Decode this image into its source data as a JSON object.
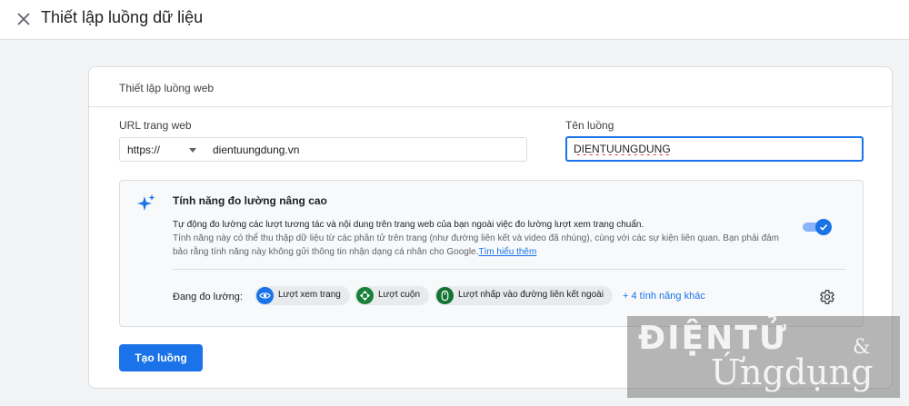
{
  "header": {
    "title": "Thiết lập luồng dữ liệu",
    "close_icon": "close-icon"
  },
  "card": {
    "header": "Thiết lập luồng web",
    "url_label": "URL trang web",
    "protocol_value": "https://",
    "url_value": "dientuungdung.vn",
    "stream_name_label": "Tên luồng",
    "stream_name_value": "DIENTUUNGDUNG"
  },
  "enhanced": {
    "title": "Tính năng đo lường nâng cao",
    "desc_line1": "Tự động đo lường các lượt tương tác và nội dung trên trang web của bạn ngoài việc đo lường lượt xem trang chuẩn.",
    "desc_line2": "Tính năng này có thể thu thập dữ liệu từ các phần tử trên trang (như đường liên kết và video đã nhúng), cùng với các sự kiện liên quan. Bạn phải đảm",
    "desc_line3": "bảo rằng tính năng này không gửi thông tin nhận dạng cá nhân cho Google.",
    "learn_more": "Tìm hiểu thêm",
    "toggle_on": true,
    "measuring_label": "Đang đo lường:",
    "chips": [
      {
        "label": "Lượt xem trang",
        "icon": "eye-icon",
        "color": "#1a73e8"
      },
      {
        "label": "Lượt cuộn",
        "icon": "scroll-icon",
        "color": "#188038"
      },
      {
        "label": "Lượt nhấp vào đường liên kết ngoài",
        "icon": "mouse-icon",
        "color": "#137333"
      }
    ],
    "more_features": "+ 4 tính năng khác"
  },
  "create_button": "Tạo luồng",
  "watermark": {
    "top": "ĐIỆNTỬ",
    "amp": "&",
    "bottom": "Ứngdụng"
  },
  "colors": {
    "accent": "#1a73e8",
    "background": "#f1f3f4"
  }
}
